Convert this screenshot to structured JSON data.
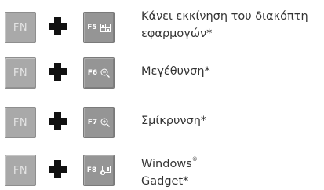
{
  "rows": [
    {
      "fn_label": "FN",
      "key_label": "F5",
      "key_icon": "app-switcher-icon",
      "description_line1": "Κάνει εκκίνηση του διακόπτη",
      "description_line2": "εφαρμογών*"
    },
    {
      "fn_label": "FN",
      "key_label": "F6",
      "key_icon": "zoom-out-icon",
      "description_line1": "Μεγέθυνση*"
    },
    {
      "fn_label": "FN",
      "key_label": "F7",
      "key_icon": "zoom-in-icon",
      "description_line1": "Σμίκρυνση*"
    },
    {
      "fn_label": "FN",
      "key_label": "F8",
      "key_icon": "windows-gadget-icon",
      "description_line1": "Windows",
      "description_mark": "®",
      "description_line2": "Gadget*"
    }
  ]
}
